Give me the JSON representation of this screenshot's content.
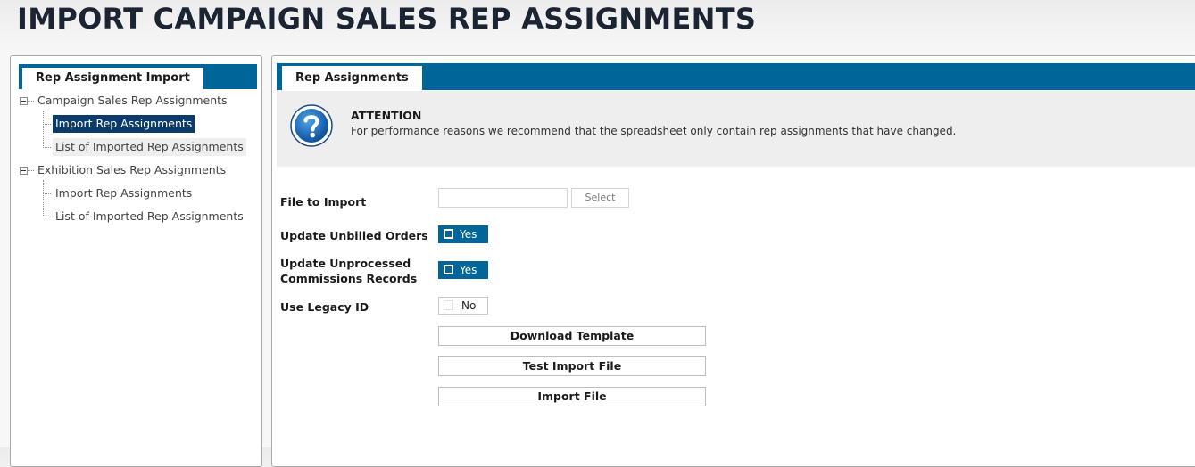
{
  "page": {
    "title": "IMPORT CAMPAIGN SALES REP ASSIGNMENTS"
  },
  "left_panel": {
    "tab_label": "Rep Assignment Import",
    "tree": {
      "groups": [
        {
          "label": "Campaign Sales Rep Assignments",
          "items": [
            {
              "label": "Import Rep Assignments",
              "state": "selected"
            },
            {
              "label": "List of Imported Rep Assignments",
              "state": "hovered"
            }
          ]
        },
        {
          "label": "Exhibition Sales Rep Assignments",
          "items": [
            {
              "label": "Import Rep Assignments",
              "state": "normal"
            },
            {
              "label": "List of Imported Rep Assignments",
              "state": "normal"
            }
          ]
        }
      ]
    }
  },
  "right_panel": {
    "tab_label": "Rep Assignments",
    "attention": {
      "icon": "question-icon",
      "title": "ATTENTION",
      "message": "For performance reasons we recommend that the spreadsheet only contain rep assignments that have changed."
    },
    "form": {
      "file_to_import": {
        "label": "File to Import",
        "value": "",
        "select_label": "Select"
      },
      "update_unbilled": {
        "label": "Update Unbilled Orders",
        "toggle_label": "Yes",
        "checked": true
      },
      "update_unprocessed": {
        "label_line1": "Update Unprocessed",
        "label_line2": "Commissions Records",
        "toggle_label": "Yes",
        "checked": true
      },
      "use_legacy_id": {
        "label": "Use Legacy ID",
        "toggle_label": "No",
        "checked": false
      },
      "buttons": {
        "download_template": "Download Template",
        "test_import_file": "Test Import File",
        "import_file": "Import File"
      }
    }
  },
  "colors": {
    "accent": "#006599",
    "selected_bg": "#0a3b6b",
    "title_text": "#1a2433",
    "attention_bg": "#eeeeee"
  }
}
